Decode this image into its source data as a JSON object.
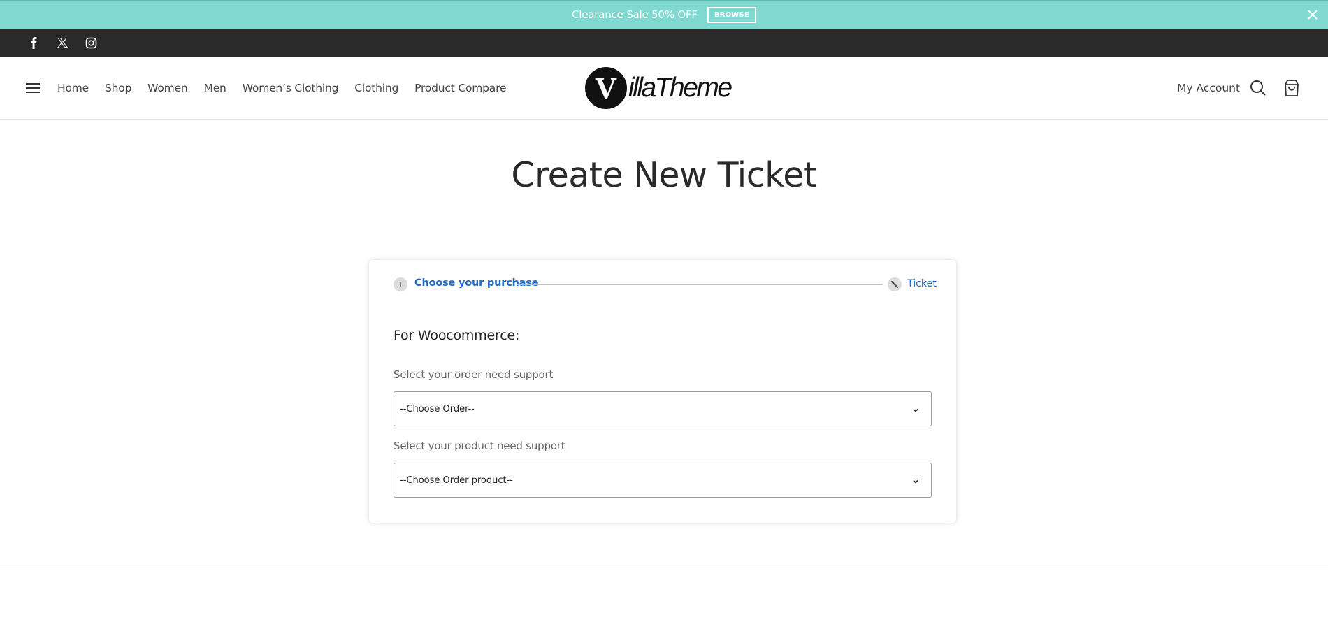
{
  "announcement": {
    "text": "Clearance Sale 50% OFF",
    "button_label": "BROWSE"
  },
  "social": {
    "icons": [
      "facebook-icon",
      "x-twitter-icon",
      "instagram-icon"
    ]
  },
  "header": {
    "nav_items": [
      "Home",
      "Shop",
      "Women",
      "Men",
      "Women’s Clothing",
      "Clothing",
      "Product Compare"
    ],
    "logo": {
      "mark": "V",
      "text": "illaTheme"
    },
    "account_label": "My Account"
  },
  "page": {
    "title": "Create New Ticket"
  },
  "ticket_form": {
    "steps": [
      {
        "number": "1",
        "label": "Choose your purchase"
      },
      {
        "label": "Ticket"
      }
    ],
    "section_heading": "For Woocommerce:",
    "order_label": "Select your order need support",
    "order_select_value": "--Choose Order--",
    "product_label": "Select your product need support",
    "product_select_value": "--Choose Order product--"
  },
  "colors": {
    "announcement_bg": "#80d9d1",
    "social_bar_bg": "#2a2a2a",
    "link_blue": "#1e6cc7"
  }
}
